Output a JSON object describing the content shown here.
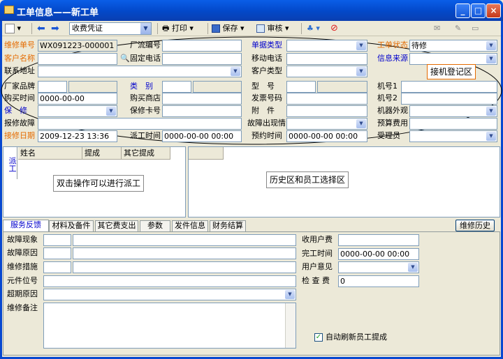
{
  "window": {
    "title": "工单信息——新工单"
  },
  "toolbar": {
    "receipt_select": "收费凭证",
    "print": "打印",
    "save": "保存",
    "audit": "审核"
  },
  "form": {
    "repair_no_label": "维修单号",
    "repair_no": "WX091223-000001",
    "factory_no_label": "厂流编号",
    "doc_type_label": "单据类型",
    "status_label": "工单状态",
    "status": "待修",
    "customer_label": "客户名称",
    "fixed_phone_label": "固定电话",
    "mobile_label": "移动电话",
    "info_source_label": "信息来源",
    "address_label": "联系地址",
    "customer_type_label": "客户类型",
    "factory_brand_label": "厂家品牌",
    "category_label": "类　别",
    "model_label": "型　号",
    "machine1_label": "机号1",
    "purchase_time_label": "购买时间",
    "purchase_time": "0000-00-00",
    "store_label": "购买商店",
    "invoice_label": "发票号码",
    "machine2_label": "机号2",
    "warranty_label": "保　修",
    "warranty_card_label": "保修卡号",
    "accessory_label": "附　件",
    "appearance_label": "机器外观",
    "fault_report_label": "报修故障",
    "fault_condition_label": "故障出现情",
    "budget_label": "预算费用",
    "report_date_label": "接修日期",
    "report_date": "2009-12-23 13:36",
    "dispatch_time_label": "派工时间",
    "dispatch_time": "0000-00-00 00:00",
    "appointment_label": "预约时间",
    "appointment": "0000-00-00 00:00",
    "handler_label": "受理员"
  },
  "callouts": {
    "reception": "接机登记区",
    "dispatch": "双击操作可以进行派工",
    "history": "历史区和员工选择区"
  },
  "dispatch": {
    "side_tab": "派工",
    "columns": [
      "姓名",
      "提成",
      "其它提成"
    ]
  },
  "tabs": [
    "服务反馈",
    "材料及备件",
    "其它费支出",
    "参数",
    "发件信息",
    "财务结算"
  ],
  "repair_history_button": "维修历史",
  "feedback": {
    "fault_symptom": "故障现象",
    "fault_cause": "故障原因",
    "measures": "维修措施",
    "component_no": "元件位号",
    "overdue_reason": "超期原因",
    "remarks": "维修备注",
    "fee_label": "收用户费",
    "finish_label": "完工时间",
    "finish": "0000-00-00 00:00",
    "opinion_label": "用户意见",
    "check_fee_label": "检 查 费",
    "check_fee": "0",
    "auto_refresh": "自动刷新员工提成"
  }
}
